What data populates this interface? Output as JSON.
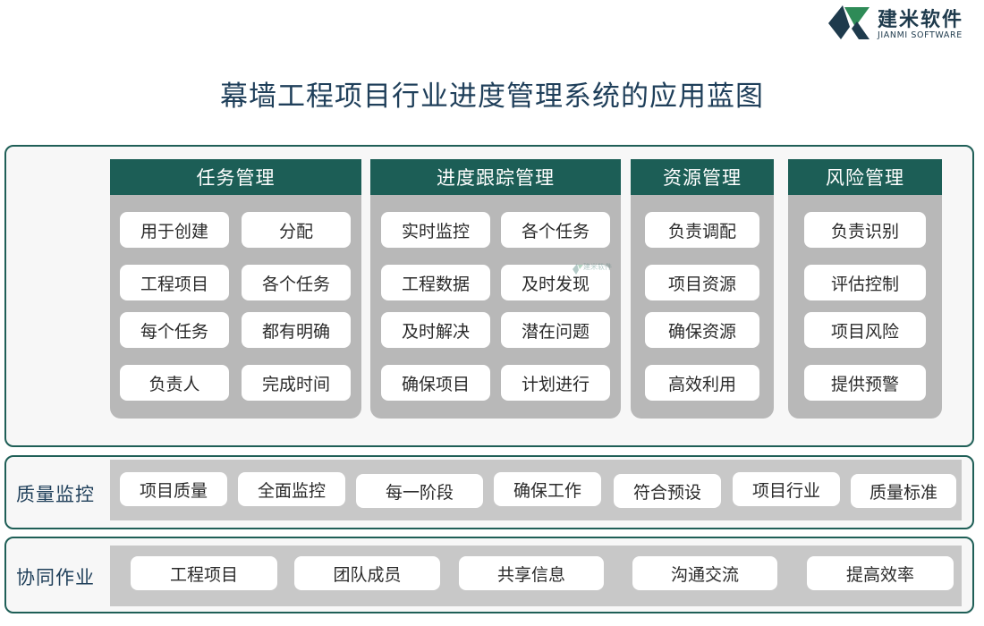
{
  "logo": {
    "cn": "建米软件",
    "en": "JIANMI SOFTWARE"
  },
  "title": "幕墙工程项目行业进度管理系统的应用蓝图",
  "modules": [
    {
      "title": "任务管理",
      "items": [
        "用于创建",
        "分配",
        "工程项目",
        "各个任务",
        "每个任务",
        "都有明确",
        "负责人",
        "完成时间"
      ]
    },
    {
      "title": "进度跟踪管理",
      "items": [
        "实时监控",
        "各个任务",
        "工程数据",
        "及时发现",
        "及时解决",
        "潜在问题",
        "确保项目",
        "计划进行"
      ]
    },
    {
      "title": "资源管理",
      "items": [
        "负责调配",
        "项目资源",
        "确保资源",
        "高效利用"
      ]
    },
    {
      "title": "风险管理",
      "items": [
        "负责识别",
        "评估控制",
        "项目风险",
        "提供预警"
      ]
    }
  ],
  "quality": {
    "label": "质量监控",
    "items": [
      "项目质量",
      "全面监控",
      "每一阶段",
      "确保工作",
      "符合预设",
      "项目行业",
      "质量标准"
    ]
  },
  "collab": {
    "label": "协同作业",
    "items": [
      "工程项目",
      "团队成员",
      "共享信息",
      "沟通交流",
      "提高效率"
    ]
  },
  "watermark": "建米软件"
}
